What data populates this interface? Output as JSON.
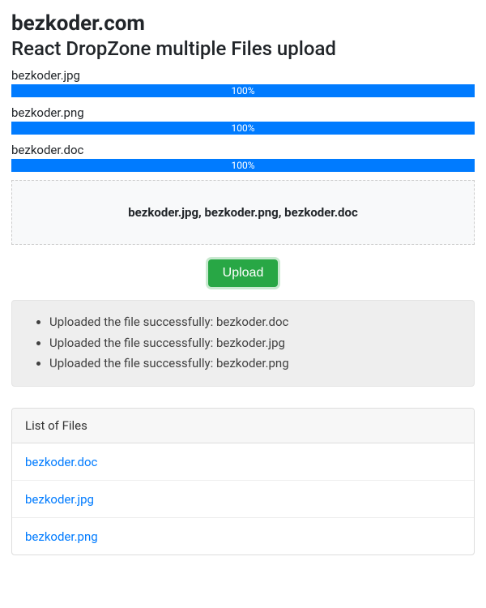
{
  "header": {
    "site_title": "bezkoder.com",
    "page_title": "React DropZone multiple Files upload"
  },
  "progress_items": [
    {
      "filename": "bezkoder.jpg",
      "percent_text": "100%",
      "percent_value": 100
    },
    {
      "filename": "bezkoder.png",
      "percent_text": "100%",
      "percent_value": 100
    },
    {
      "filename": "bezkoder.doc",
      "percent_text": "100%",
      "percent_value": 100
    }
  ],
  "dropzone": {
    "selected_text": "bezkoder.jpg, bezkoder.png, bezkoder.doc"
  },
  "actions": {
    "upload_label": "Upload"
  },
  "messages": [
    "Uploaded the file successfully: bezkoder.doc",
    "Uploaded the file successfully: bezkoder.jpg",
    "Uploaded the file successfully: bezkoder.png"
  ],
  "file_list": {
    "header": "List of Files",
    "items": [
      "bezkoder.doc",
      "bezkoder.jpg",
      "bezkoder.png"
    ]
  }
}
